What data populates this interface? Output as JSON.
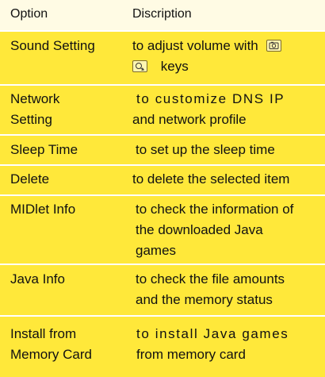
{
  "colors": {
    "header_bg": "#fffbe4",
    "row_bg": "#ffe83a",
    "divider": "#ffffff",
    "text": "#111111"
  },
  "table": {
    "header": {
      "option": "Option",
      "description": "Discription"
    },
    "rows": [
      {
        "option_lines": [
          "Sound Setting"
        ],
        "description_lines": [
          "to adjust volume with",
          "keys"
        ],
        "icons": [
          "camera-key-icon",
          "navigation-key-icon"
        ]
      },
      {
        "option_lines": [
          "Network",
          "Setting"
        ],
        "description_lines": [
          "to customize DNS IP",
          "and network profile"
        ]
      },
      {
        "option_lines": [
          "Sleep Time"
        ],
        "description_lines": [
          "to set up the sleep time"
        ]
      },
      {
        "option_lines": [
          "Delete"
        ],
        "description_lines": [
          "to delete the selected item"
        ]
      },
      {
        "option_lines": [
          "MIDlet Info"
        ],
        "description_lines": [
          "to check the information of",
          "the downloaded Java",
          "games"
        ]
      },
      {
        "option_lines": [
          "Java Info"
        ],
        "description_lines": [
          "to check the file amounts",
          "and the memory status"
        ]
      },
      {
        "option_lines": [
          "Install from",
          "Memory Card"
        ],
        "description_lines": [
          "to install Java games",
          "from memory card"
        ]
      }
    ]
  }
}
